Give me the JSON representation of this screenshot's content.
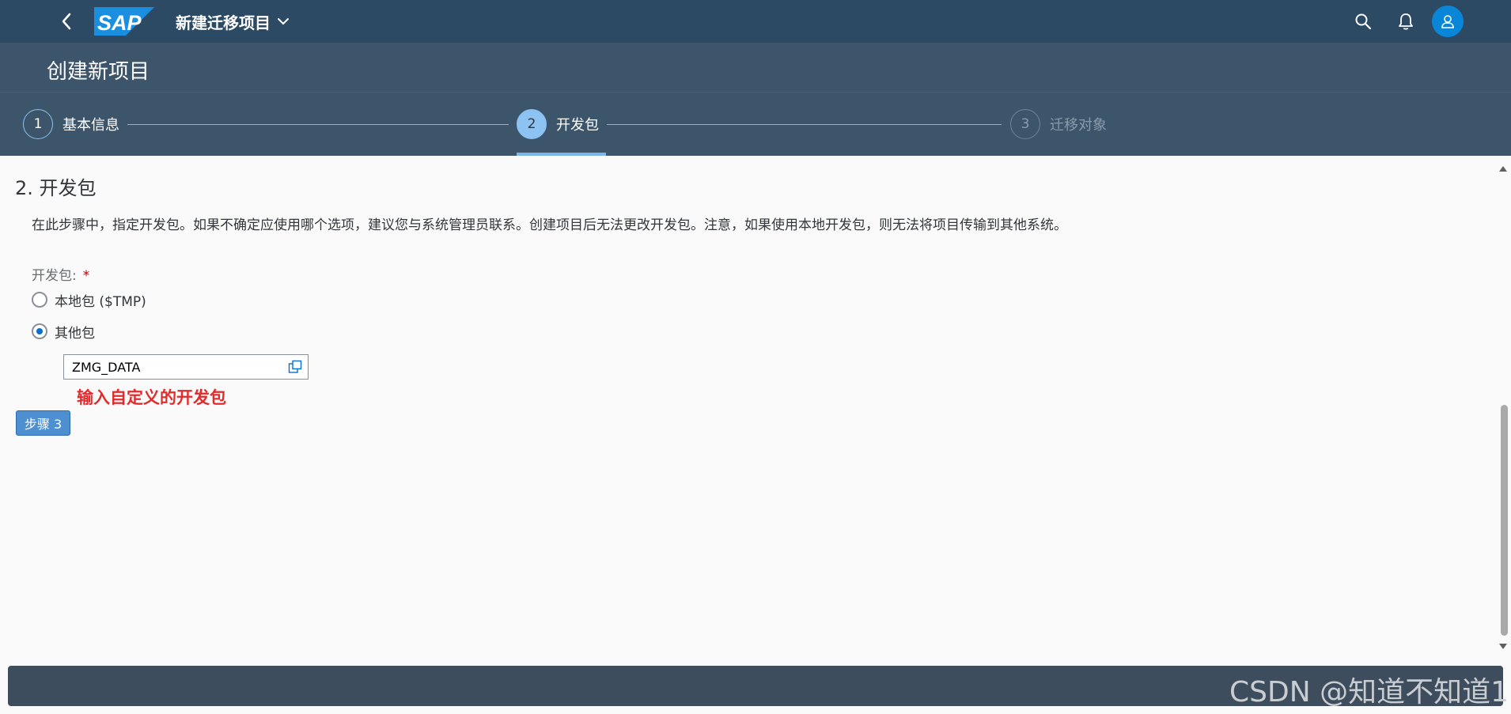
{
  "shell": {
    "logo_text": "SAP",
    "app_title": "新建迁移项目",
    "icons": [
      "back-icon",
      "chevron-down-icon",
      "search-icon",
      "bell-icon",
      "user-icon"
    ],
    "accent_color": "#0a86d8",
    "bar_color": "#2c4a63"
  },
  "page": {
    "title": "创建新项目"
  },
  "wizard": {
    "steps": [
      {
        "number": "1",
        "label": "基本信息",
        "state": "completed"
      },
      {
        "number": "2",
        "label": "开发包",
        "state": "current"
      },
      {
        "number": "3",
        "label": "迁移对象",
        "state": "pending"
      }
    ]
  },
  "content": {
    "section_title": "2. 开发包",
    "description": "在此步骤中，指定开发包。如果不确定应使用哪个选项，建议您与系统管理员联系。创建项目后无法更改开发包。注意，如果使用本地开发包，则无法将项目传输到其他系统。",
    "field_label": "开发包:",
    "required_mark": "*",
    "radio_options": [
      {
        "label": "本地包 ($TMP)",
        "selected": false
      },
      {
        "label": "其他包",
        "selected": true
      }
    ],
    "package_input_value": "ZMG_DATA",
    "annotation": "输入自定义的开发包",
    "step_button_label": "步骤 3"
  },
  "watermark": "CSDN @知道不知道1"
}
